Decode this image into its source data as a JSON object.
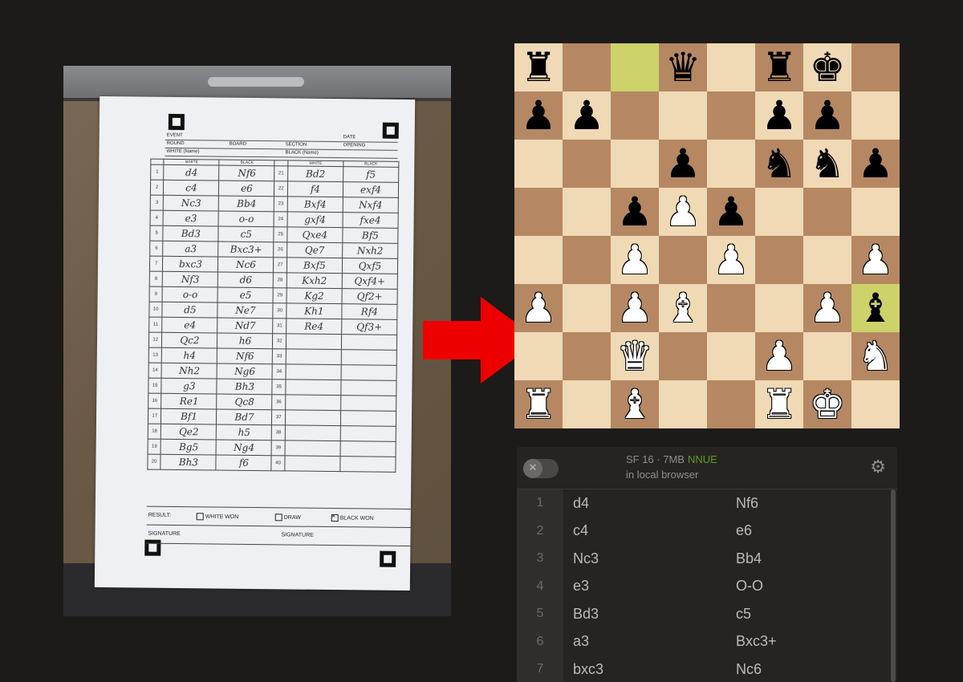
{
  "scoresheet": {
    "header_labels": {
      "event": "EVENT",
      "date": "DATE",
      "round": "ROUND",
      "board": "BOARD",
      "section": "SECTION",
      "opening": "OPENING",
      "white_name": "WHITE (Name)",
      "black_name": "BLACK (Name)",
      "white": "WHITE",
      "black": "BLACK"
    },
    "left_moves": [
      {
        "n": "1",
        "w": "d4",
        "b": "Nf6"
      },
      {
        "n": "2",
        "w": "c4",
        "b": "e6"
      },
      {
        "n": "3",
        "w": "Nc3",
        "b": "Bb4"
      },
      {
        "n": "4",
        "w": "e3",
        "b": "o-o"
      },
      {
        "n": "5",
        "w": "Bd3",
        "b": "c5"
      },
      {
        "n": "6",
        "w": "a3",
        "b": "Bxc3+"
      },
      {
        "n": "7",
        "w": "bxc3",
        "b": "Nc6"
      },
      {
        "n": "8",
        "w": "Nf3",
        "b": "d6"
      },
      {
        "n": "9",
        "w": "o-o",
        "b": "e5"
      },
      {
        "n": "10",
        "w": "d5",
        "b": "Ne7"
      },
      {
        "n": "11",
        "w": "e4",
        "b": "Nd7"
      },
      {
        "n": "12",
        "w": "Qc2",
        "b": "h6"
      },
      {
        "n": "13",
        "w": "h4",
        "b": "Nf6"
      },
      {
        "n": "14",
        "w": "Nh2",
        "b": "Ng6"
      },
      {
        "n": "15",
        "w": "g3",
        "b": "Bh3"
      },
      {
        "n": "16",
        "w": "Re1",
        "b": "Qc8"
      },
      {
        "n": "17",
        "w": "Bf1",
        "b": "Bd7"
      },
      {
        "n": "18",
        "w": "Qe2",
        "b": "h5"
      },
      {
        "n": "19",
        "w": "Bg5",
        "b": "Ng4"
      },
      {
        "n": "20",
        "w": "Bh3",
        "b": "f6"
      }
    ],
    "right_moves": [
      {
        "n": "21",
        "w": "Bd2",
        "b": "f5"
      },
      {
        "n": "22",
        "w": "f4",
        "b": "exf4"
      },
      {
        "n": "23",
        "w": "Bxf4",
        "b": "Nxf4"
      },
      {
        "n": "24",
        "w": "gxf4",
        "b": "fxe4"
      },
      {
        "n": "25",
        "w": "Qxe4",
        "b": "Bf5"
      },
      {
        "n": "26",
        "w": "Qe7",
        "b": "Nxh2"
      },
      {
        "n": "27",
        "w": "Bxf5",
        "b": "Qxf5"
      },
      {
        "n": "28",
        "w": "Kxh2",
        "b": "Qxf4+"
      },
      {
        "n": "29",
        "w": "Kg2",
        "b": "Qf2+"
      },
      {
        "n": "30",
        "w": "Kh1",
        "b": "Rf4"
      },
      {
        "n": "31",
        "w": "Re4",
        "b": "Qf3+"
      },
      {
        "n": "32",
        "w": "",
        "b": ""
      },
      {
        "n": "33",
        "w": "",
        "b": ""
      },
      {
        "n": "34",
        "w": "",
        "b": ""
      },
      {
        "n": "35",
        "w": "",
        "b": ""
      },
      {
        "n": "36",
        "w": "",
        "b": ""
      },
      {
        "n": "37",
        "w": "",
        "b": ""
      },
      {
        "n": "38",
        "w": "",
        "b": ""
      },
      {
        "n": "39",
        "w": "",
        "b": ""
      },
      {
        "n": "40",
        "w": "",
        "b": ""
      }
    ],
    "footer": {
      "result": "RESULT:",
      "white_won": "WHITE WON",
      "draw": "DRAW",
      "black_won": "BLACK WON",
      "signature": "SIGNATURE"
    }
  },
  "board": {
    "ranks": [
      [
        "bR",
        "",
        "",
        "bQ",
        "",
        "bR",
        "bK",
        ""
      ],
      [
        "bP",
        "bP",
        "",
        "",
        "",
        "bP",
        "bP",
        ""
      ],
      [
        "",
        "",
        "",
        "bP",
        "",
        "bN",
        "bN",
        "bP"
      ],
      [
        "",
        "",
        "bP",
        "wP",
        "bP",
        "",
        "",
        ""
      ],
      [
        "",
        "",
        "wP",
        "",
        "wP",
        "",
        "",
        "wP"
      ],
      [
        "wP",
        "",
        "wP",
        "wB",
        "",
        "",
        "wP",
        "bB"
      ],
      [
        "",
        "",
        "wQ",
        "",
        "",
        "wP",
        "",
        "wN"
      ],
      [
        "wR",
        "",
        "wB",
        "",
        "",
        "wR",
        "wK",
        ""
      ]
    ],
    "highlighted": [
      "c8",
      "h3"
    ]
  },
  "engine": {
    "name": "SF 16 · 7MB",
    "badge": "NNUE",
    "location": "in local browser",
    "toggle_icon": "✕",
    "settings_icon": "⚙"
  },
  "moves": [
    {
      "num": "1",
      "white": "d4",
      "black": "Nf6"
    },
    {
      "num": "2",
      "white": "c4",
      "black": "e6"
    },
    {
      "num": "3",
      "white": "Nc3",
      "black": "Bb4"
    },
    {
      "num": "4",
      "white": "e3",
      "black": "O-O"
    },
    {
      "num": "5",
      "white": "Bd3",
      "black": "c5"
    },
    {
      "num": "6",
      "white": "a3",
      "black": "Bxc3+"
    },
    {
      "num": "7",
      "white": "bxc3",
      "black": "Nc6"
    }
  ]
}
